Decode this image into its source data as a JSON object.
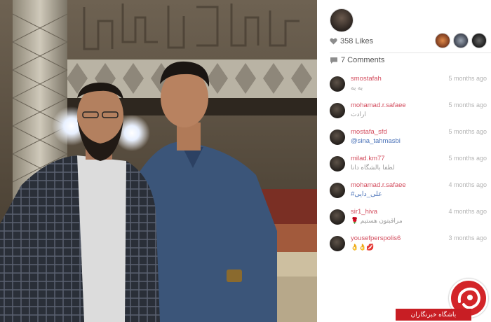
{
  "post": {
    "likes_label": "358 Likes",
    "comments_label": "7 Comments",
    "heart_icon": "heart-icon",
    "comment_icon": "comment-icon"
  },
  "comments": [
    {
      "user": "smostafah",
      "text": "به به",
      "time": "5 months ago"
    },
    {
      "user": "mohamad.r.safaee",
      "text": "ارادت",
      "time": "5 months ago"
    },
    {
      "user": "mostafa_sfd",
      "text": "@sina_tahmasbi",
      "time": "5 months ago"
    },
    {
      "user": "milad.km77",
      "text": "لطفا بالشگاه دانا",
      "time": "5 months ago"
    },
    {
      "user": "mohamad.r.safaee",
      "text": "#علی_دایی",
      "time": "4 months ago"
    },
    {
      "user": "sir1_hiva",
      "text": "🌹 مراقبتون هستیم",
      "time": "4 months ago"
    },
    {
      "user": "yousefperspolis6",
      "text": "👌👌💋",
      "time": "3 months ago"
    }
  ],
  "watermark": {
    "label": "باشگاه خبرنگاران",
    "color": "#c81e24"
  }
}
